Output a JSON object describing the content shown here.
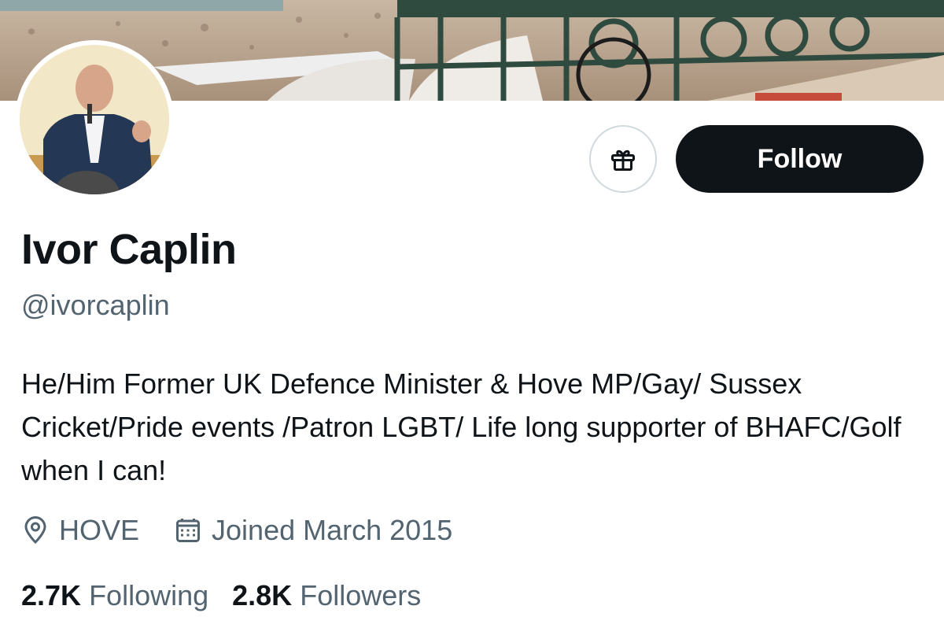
{
  "profile": {
    "name": "Ivor Caplin",
    "handle": "@ivorcaplin",
    "bio": "He/Him Former UK Defence Minister & Hove MP/Gay/ Sussex Cricket/Pride events /Patron LGBT/ Life long supporter of BHAFC/Golf when I can!",
    "location": "HOVE",
    "joined": "Joined March 2015",
    "following_count": "2.7K",
    "following_label": "Following",
    "followers_count": "2.8K",
    "followers_label": "Followers"
  },
  "actions": {
    "follow_label": "Follow",
    "gift_icon": "gift-icon"
  },
  "banner": {
    "description_icon": "banner-photo"
  },
  "colors": {
    "primary_text": "#0f1419",
    "secondary_text": "#536471",
    "follow_bg": "#0f1419",
    "border": "#cfd9de"
  }
}
